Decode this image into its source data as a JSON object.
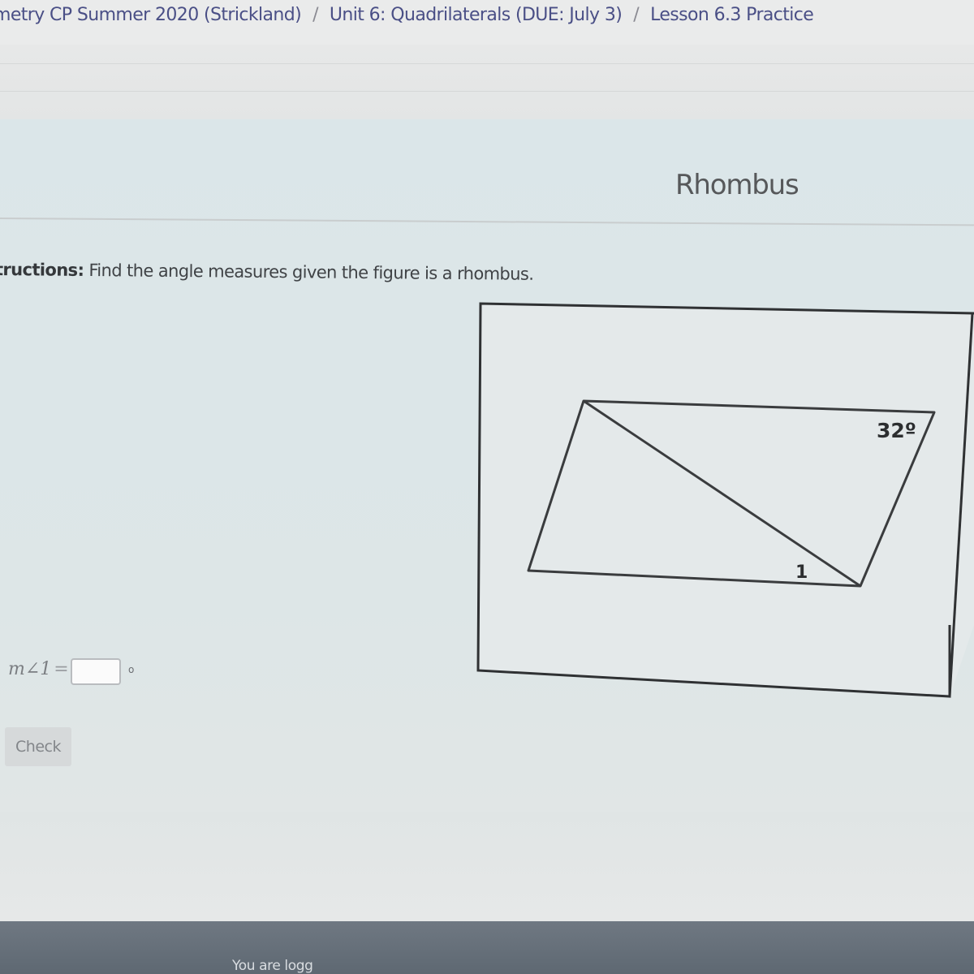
{
  "breadcrumb": {
    "items": [
      {
        "label": "metry CP Summer 2020 (Strickland)"
      },
      {
        "label": "Unit 6: Quadrilaterals (DUE: July 3)"
      },
      {
        "label": "Lesson 6.3 Practice"
      }
    ],
    "separator": "/"
  },
  "lesson": {
    "title": "Rhombus"
  },
  "instructions": {
    "label": "tructions:",
    "text": "Find the angle measures given the figure is a rhombus."
  },
  "figure": {
    "given_angle_label": "32º",
    "angle_1_label": "1"
  },
  "answer": {
    "label": "m∠1",
    "equals": "=",
    "value": "",
    "unit": "o"
  },
  "check_button": {
    "label": "Check"
  },
  "footer": {
    "text": "You are logg"
  },
  "colors": {
    "breadcrumb_link": "#4a4f86",
    "panel_background": "#dbe6e9",
    "footer_background": "#646e78",
    "figure_stroke": "#3a3c3e"
  }
}
